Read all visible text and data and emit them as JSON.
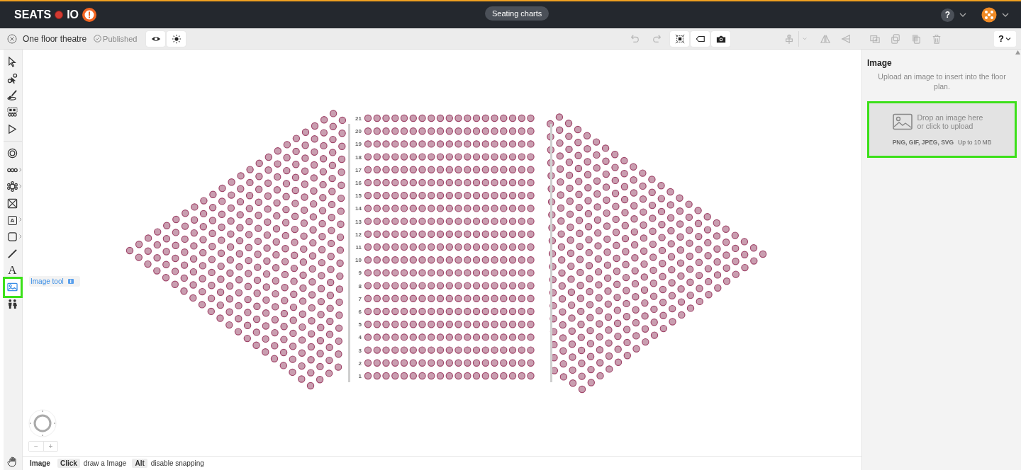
{
  "header": {
    "logo_left": "SEATS",
    "logo_right": "IO",
    "nav_button": "Seating charts",
    "help": "?"
  },
  "toolbar": {
    "chart_name": "One floor theatre",
    "status": "Published",
    "view_buttons": [
      {
        "kind": "eye",
        "disabled": false
      },
      {
        "kind": "sun",
        "disabled": false
      }
    ],
    "actions": [
      {
        "kind": "undo",
        "disabled": true
      },
      {
        "kind": "redo",
        "disabled": true
      },
      {
        "kind": "select-all",
        "disabled": false
      },
      {
        "kind": "tag",
        "disabled": false
      },
      {
        "kind": "camera",
        "disabled": false
      },
      {
        "kind": "align",
        "disabled": true
      },
      {
        "kind": "caret",
        "disabled": true
      },
      {
        "kind": "flip-h",
        "disabled": true
      },
      {
        "kind": "flip-v",
        "disabled": true
      },
      {
        "kind": "add-copy",
        "disabled": true
      },
      {
        "kind": "copy",
        "disabled": true
      },
      {
        "kind": "paste",
        "disabled": true
      },
      {
        "kind": "trash",
        "disabled": true
      }
    ],
    "help": "?"
  },
  "tools": [
    {
      "kind": "select",
      "selected": false,
      "submenu": false
    },
    {
      "kind": "node-select",
      "selected": false,
      "submenu": false
    },
    {
      "kind": "brush",
      "selected": false,
      "submenu": false
    },
    {
      "kind": "seat-select",
      "selected": false,
      "submenu": false
    },
    {
      "kind": "pointer",
      "selected": false,
      "submenu": false
    },
    {
      "kind": "round-table",
      "selected": false,
      "submenu": false
    },
    {
      "kind": "row",
      "selected": false,
      "submenu": true
    },
    {
      "kind": "table",
      "selected": false,
      "submenu": true
    },
    {
      "kind": "booth",
      "selected": false,
      "submenu": false
    },
    {
      "kind": "label-box",
      "selected": false,
      "submenu": true,
      "glyph": "A"
    },
    {
      "kind": "shape",
      "selected": false,
      "submenu": true
    },
    {
      "kind": "line",
      "selected": false,
      "submenu": false
    },
    {
      "kind": "text",
      "selected": false,
      "submenu": false,
      "glyph": "A"
    },
    {
      "kind": "image",
      "selected": true,
      "submenu": false
    },
    {
      "kind": "people",
      "selected": false,
      "submenu": false
    }
  ],
  "tooltip": {
    "label": "Image tool",
    "shortcut": "I"
  },
  "rows": [
    "21",
    "20",
    "19",
    "18",
    "17",
    "16",
    "15",
    "14",
    "13",
    "12",
    "11",
    "10",
    "9",
    "8",
    "7",
    "6",
    "5",
    "4",
    "3",
    "2",
    "1"
  ],
  "zoom": {
    "minus": "−",
    "plus": "+"
  },
  "panel": {
    "title": "Image",
    "description": "Upload an image to insert into the floor plan.",
    "dropzone": {
      "text": "Drop an image here or click to upload",
      "formats": "PNG, GIF, JPEG, SVG",
      "limit": "Up to 10 MB",
      "highlighted": true
    }
  },
  "status_bar": {
    "mode": "Image",
    "hints": [
      {
        "key": "Click",
        "action": "draw a Image"
      },
      {
        "key": "Alt",
        "action": "disable snapping"
      }
    ]
  }
}
